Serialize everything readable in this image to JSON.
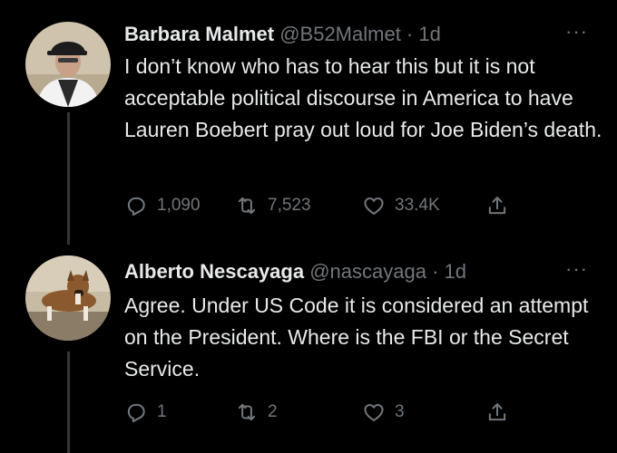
{
  "tweets": [
    {
      "display_name": "Barbara Malmet",
      "handle": "@B52Malmet",
      "separator": " · ",
      "time": "1d",
      "more": "···",
      "text": "I don’t know who has to hear this but it is not acceptable political discourse in America to have Lauren Boebert pray out loud for Joe Biden’s death.",
      "replies": "1,090",
      "retweets": "7,523",
      "likes": "33.4K"
    },
    {
      "display_name": "Alberto Nescayaga",
      "handle": "@nascayaga",
      "separator": " · ",
      "time": "1d",
      "more": "···",
      "text": "Agree. Under US Code it is considered an attempt on the President. Where is the FBI or the Secret Service.",
      "replies": "1",
      "retweets": "2",
      "likes": "3"
    }
  ],
  "colors": {
    "background": "#000000",
    "text_primary": "#e7e9ea",
    "text_secondary": "#71767b",
    "thread_line": "#333639"
  },
  "icons": [
    "reply-icon",
    "retweet-icon",
    "like-icon",
    "share-icon",
    "more-options-icon"
  ]
}
